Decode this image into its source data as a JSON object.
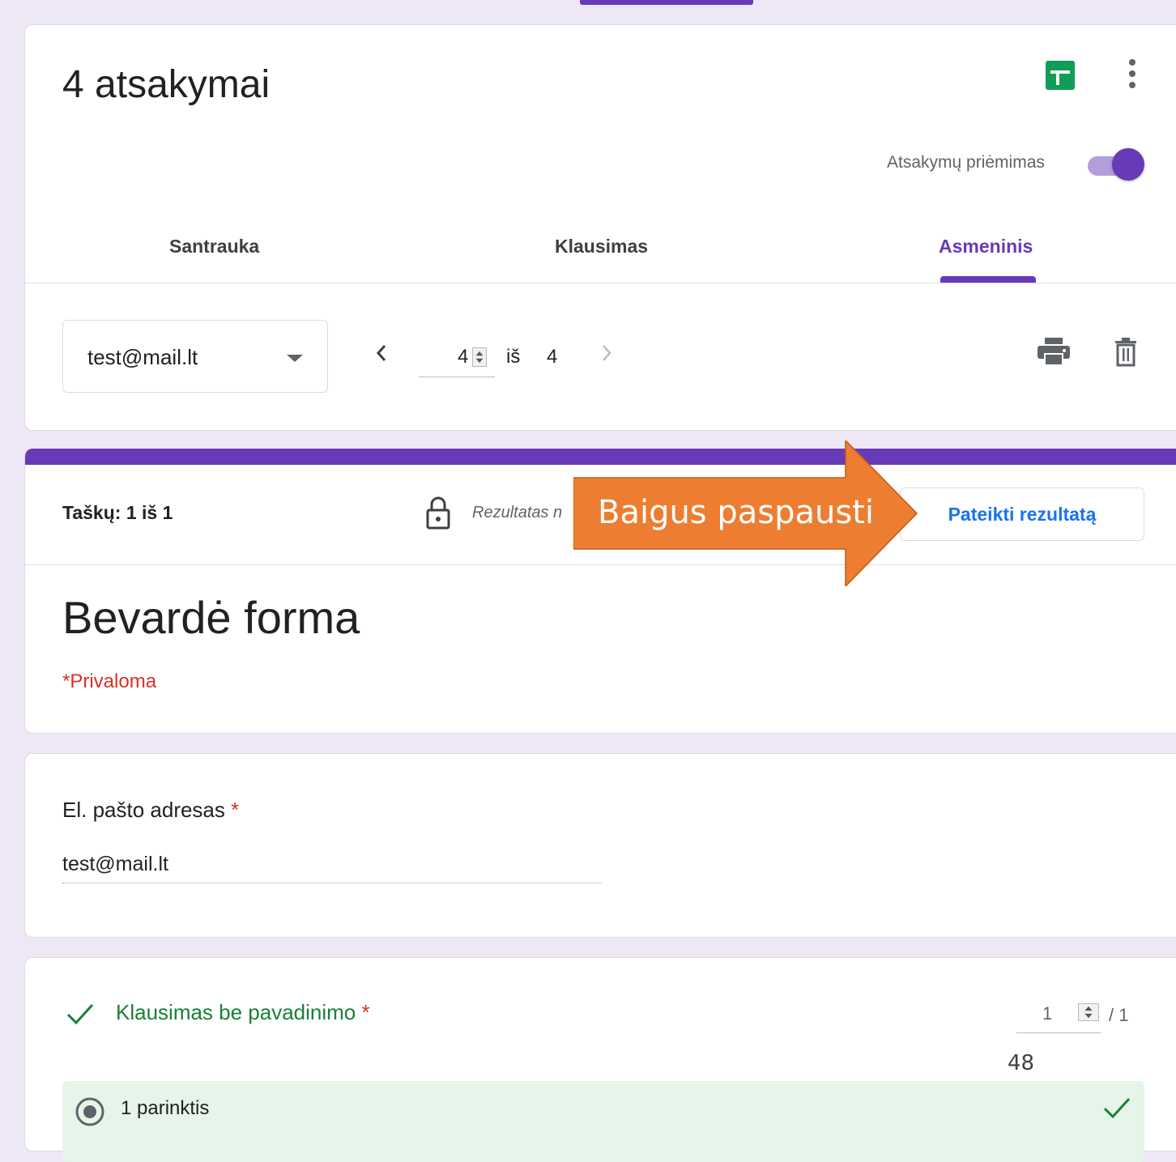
{
  "header": {
    "title": "4 atsakymai",
    "accepting_label": "Atsakymų priėmimas",
    "accepting_on": true,
    "tabs": [
      {
        "label": "Santrauka"
      },
      {
        "label": "Klausimas"
      },
      {
        "label": "Asmeninis",
        "active": true
      }
    ],
    "respondent_select": "test@mail.lt",
    "current_response": "4",
    "of_label": "iš",
    "total_responses": "4"
  },
  "response": {
    "score": "Taškų: 1 iš 1",
    "result_note": "Rezultatas n",
    "submit_label": "Pateikti rezultatą",
    "form_title": "Bevardė forma",
    "required_note": "*Privaloma"
  },
  "email_question": {
    "label": "El. pašto adresas",
    "required_mark": "*",
    "value": "test@mail.lt"
  },
  "question": {
    "label": "Klausimas be pavadinimo",
    "required_mark": "*",
    "points": "1",
    "points_max": "/ 1",
    "option_label": "1 parinktis"
  },
  "annotation": {
    "callout_text": "Baigus paspausti",
    "callout_color": "#ed7d31"
  },
  "slide": {
    "page_number": "48"
  },
  "colors": {
    "accent": "#673ab7",
    "sheets_green": "#0f9d58",
    "correct_green": "#188038",
    "required_red": "#d93025",
    "link_blue": "#1a73e8"
  }
}
